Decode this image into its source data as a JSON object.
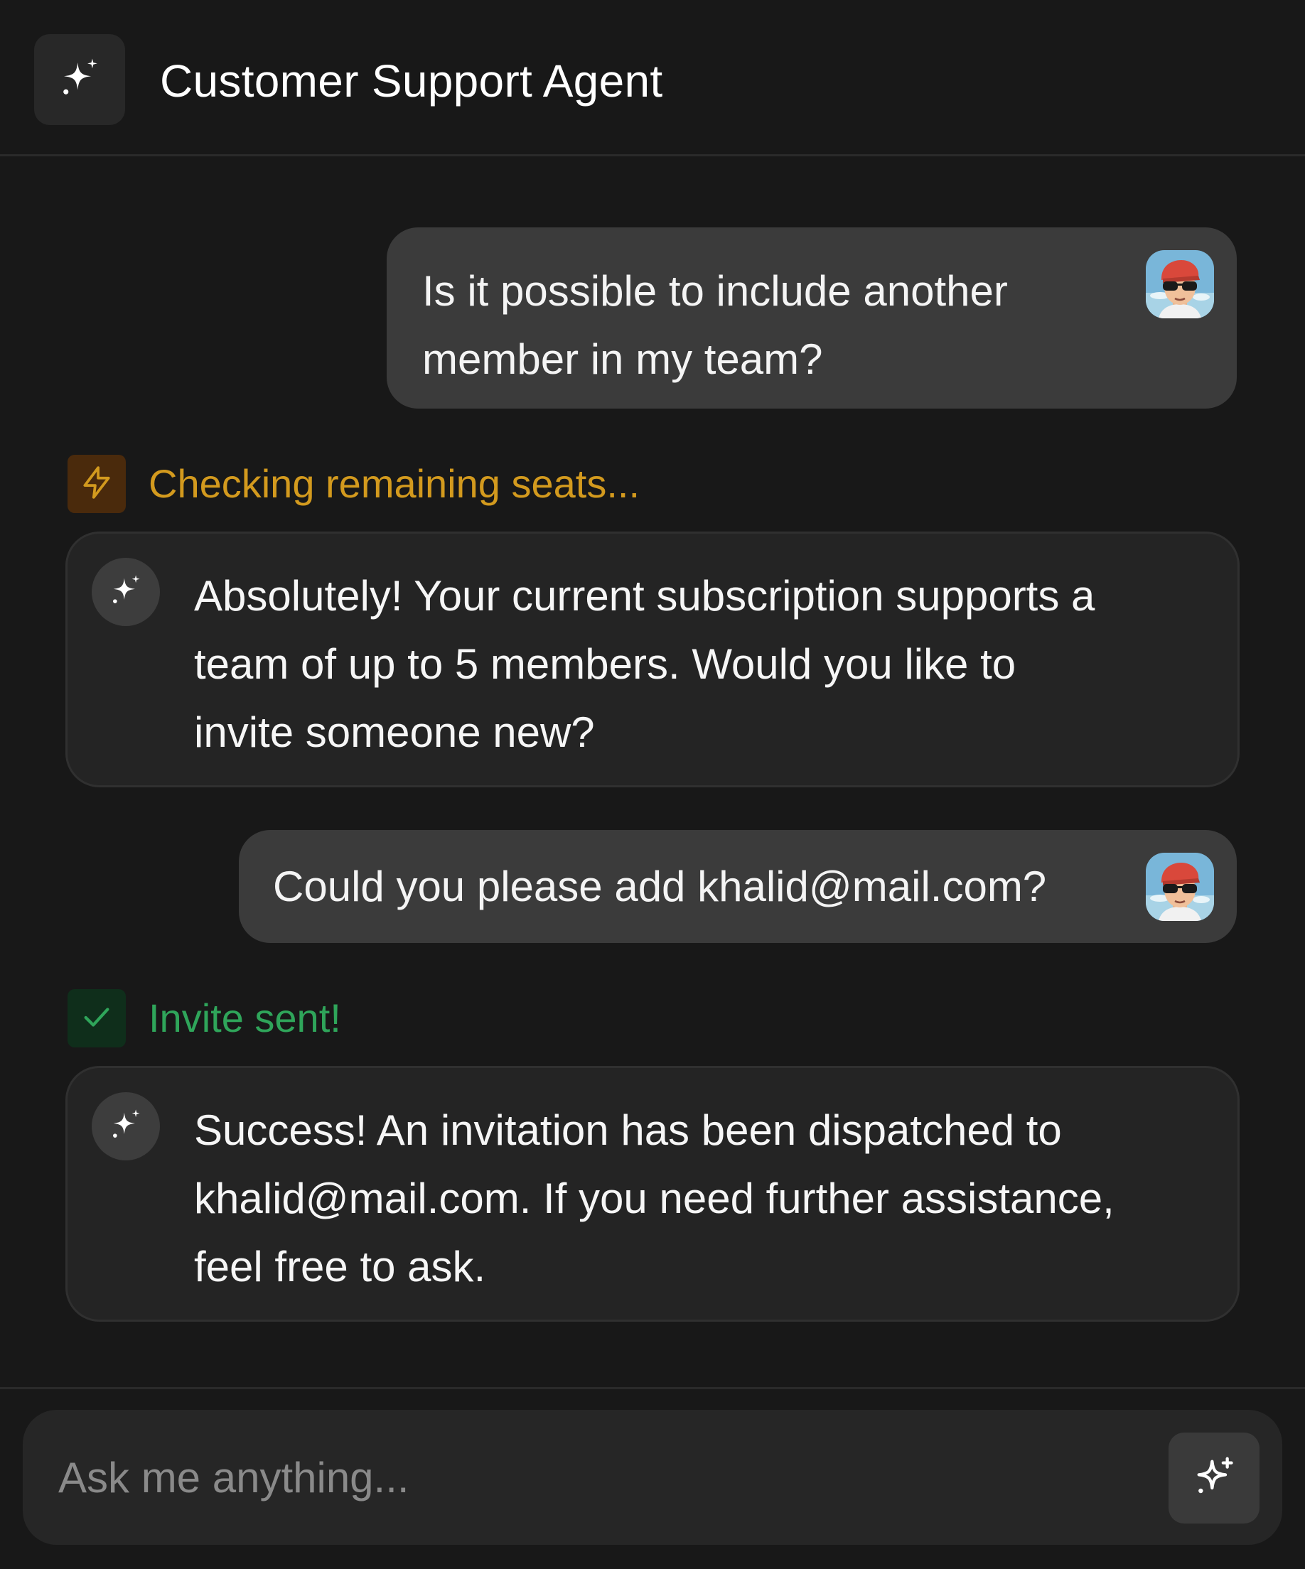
{
  "header": {
    "title": "Customer Support Agent",
    "logo_icon": "sparkles-icon"
  },
  "messages": [
    {
      "role": "user",
      "lines": [
        "Is it possible to include another",
        "member in my team?"
      ],
      "avatar": "user-avatar"
    },
    {
      "role": "status",
      "kind": "pending",
      "icon": "lightning-icon",
      "label": "Checking remaining seats...",
      "color": "#d39a1e",
      "icon_bg": "#4a2a0c"
    },
    {
      "role": "agent",
      "icon": "sparkles-icon",
      "lines": [
        "Absolutely! Your current subscription supports a",
        "team of up to 5 members. Would you like to",
        "invite someone new?"
      ]
    },
    {
      "role": "user",
      "lines": [
        "Could you please add khalid@mail.com?"
      ],
      "avatar": "user-avatar"
    },
    {
      "role": "status",
      "kind": "success",
      "icon": "check-icon",
      "label": "Invite sent!",
      "color": "#2fa55a",
      "icon_bg": "#0f2e1b"
    },
    {
      "role": "agent",
      "icon": "sparkles-icon",
      "lines": [
        "Success! An invitation has been dispatched to",
        "khalid@mail.com. If you need further assistance,",
        "feel free to ask."
      ]
    }
  ],
  "composer": {
    "placeholder": "Ask me anything...",
    "value": "",
    "send_icon": "sparkles-outline-icon"
  },
  "colors": {
    "background": "#181818",
    "user_bubble": "#3b3b3b",
    "agent_bubble": "#242424",
    "pending": "#d39a1e",
    "success": "#2fa55a"
  }
}
